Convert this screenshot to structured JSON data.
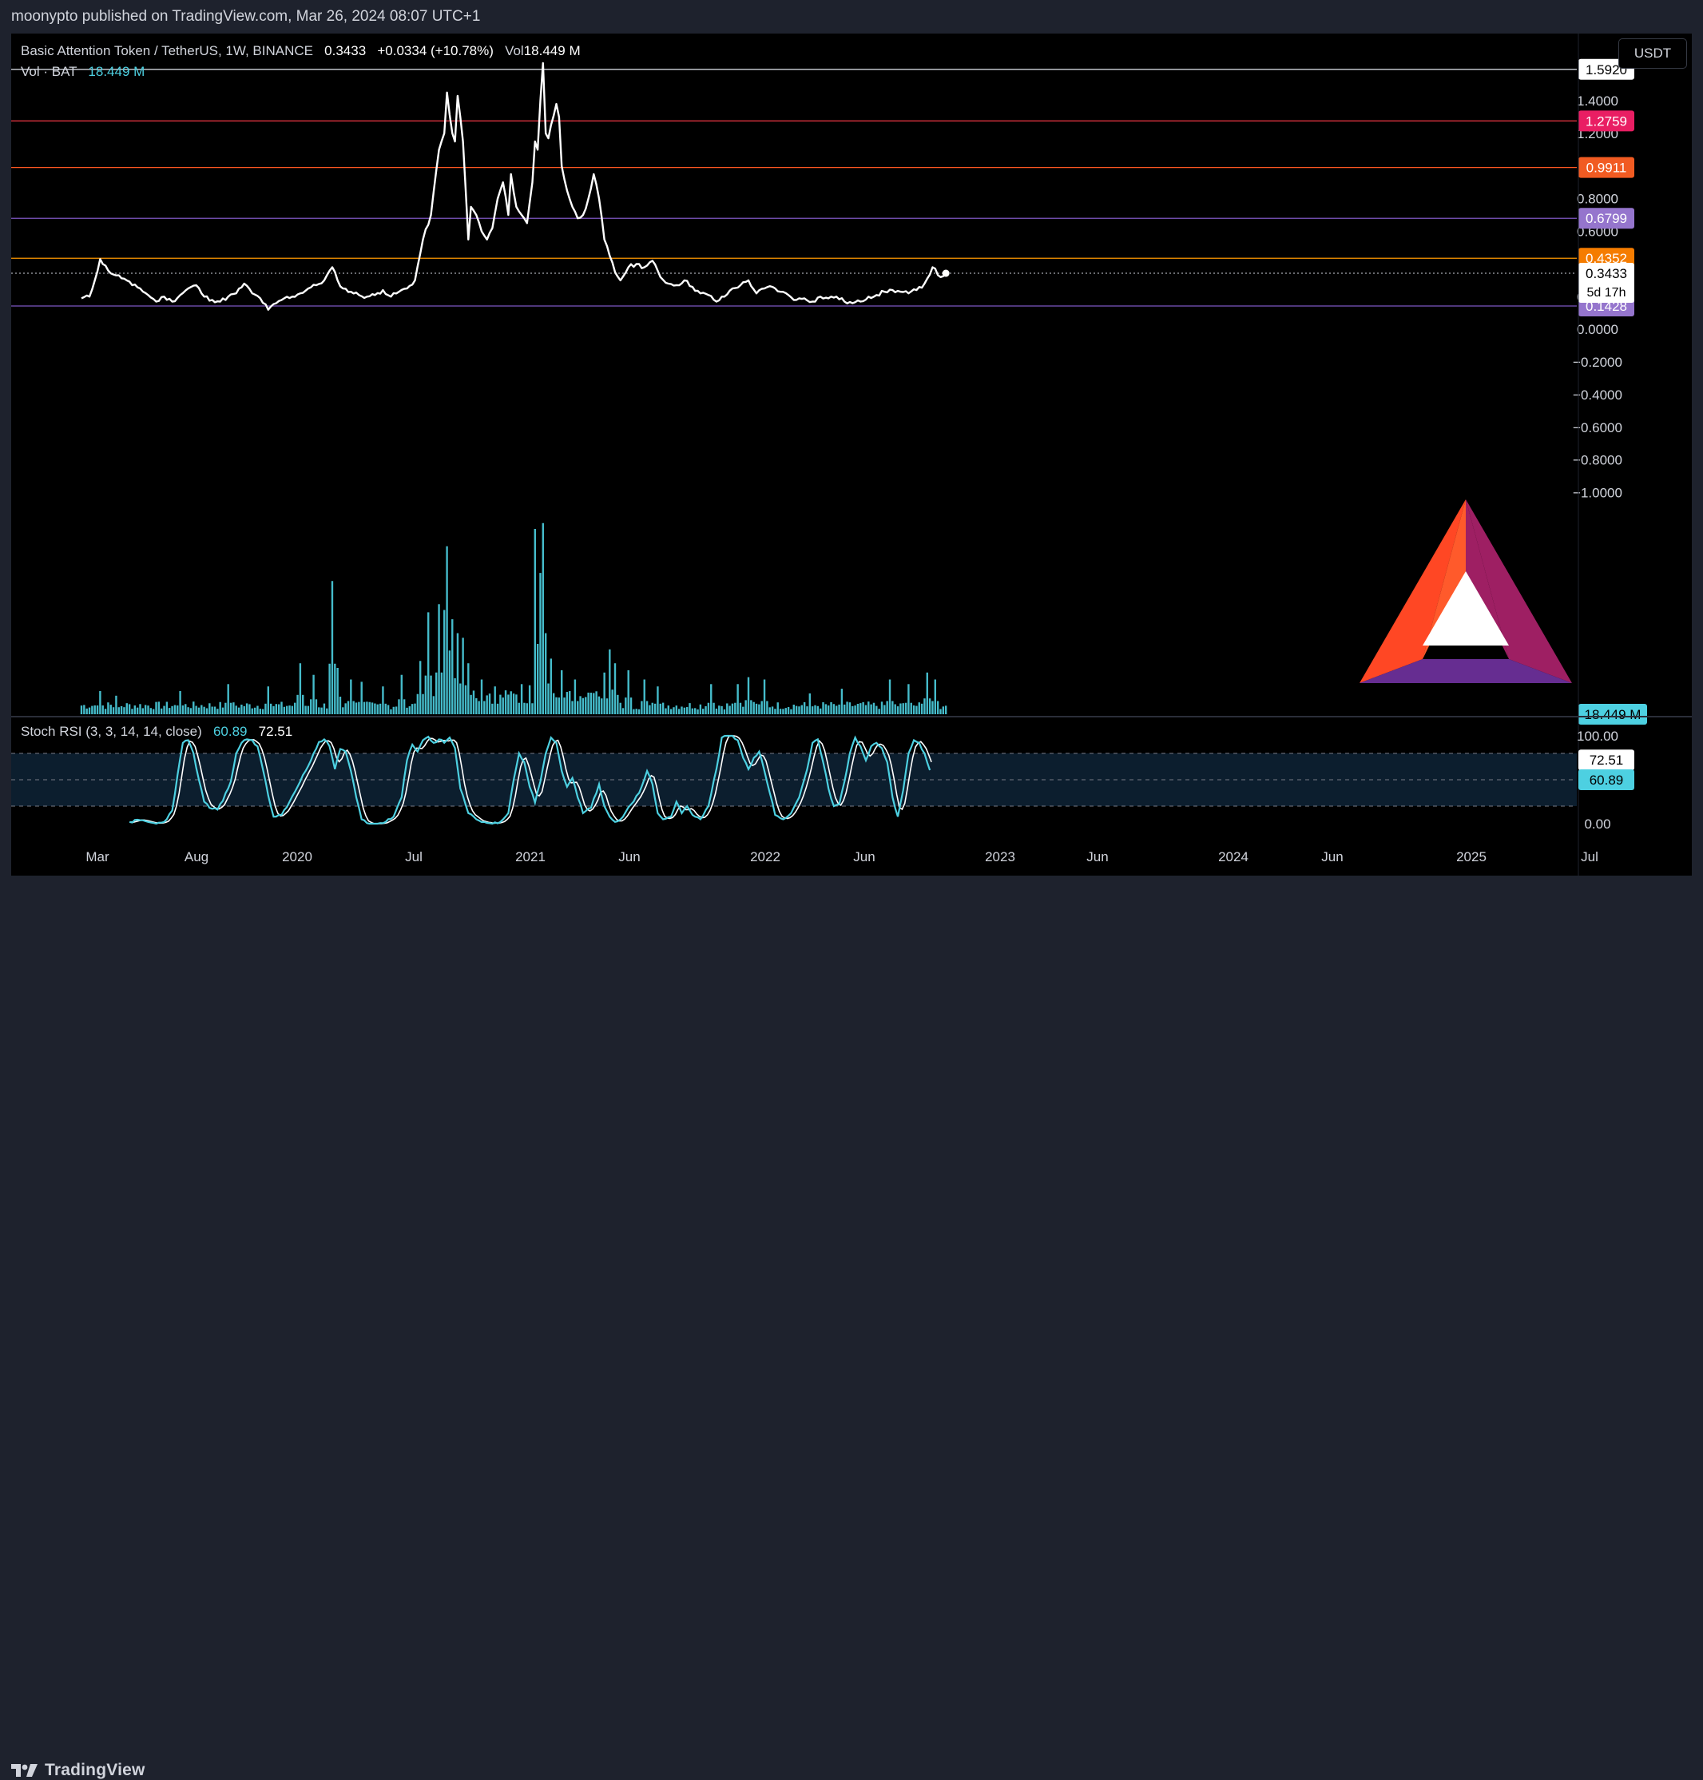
{
  "header": {
    "publisher": "moonypto published on TradingView.com, Mar 26, 2024 08:07 UTC+1"
  },
  "legend": {
    "symbol": "Basic Attention Token / TetherUS, 1W, BINANCE",
    "last": "0.3433",
    "change": "+0.0334 (+10.78%)",
    "vol_label": "Vol",
    "vol_value": "18.449 M",
    "vol_line_label": "Vol · BAT",
    "vol_line_value": "18.449 M",
    "stoch_label": "Stoch RSI (3, 3, 14, 14, close)",
    "stoch_k": "60.89",
    "stoch_d": "72.51"
  },
  "currency": "USDT",
  "colors": {
    "price_line": "#ffffff",
    "volume": "#4dd0e1",
    "stoch_k": "#4dd0e1",
    "stoch_d": "#ffffff",
    "level_white": "#d1d4dc",
    "level_red": "#f23645",
    "level_orange_red": "#ff5722",
    "level_purple": "#7e57c2",
    "level_orange": "#ff9800",
    "label_pink": "#e91e63",
    "label_orange_red": "#f15b22",
    "label_purple": "#9575cd",
    "label_orange": "#f57c00",
    "label_volume": "#4dd0e1"
  },
  "footer": {
    "brand": "TradingView",
    "logo_icon": "tradingview-logo-icon"
  },
  "watermark_icon": "bat-triangle-logo",
  "chart_data": {
    "type": "line",
    "title": "Basic Attention Token / TetherUS, 1W, BINANCE",
    "x_ticks": [
      "Mar",
      "Aug",
      "2020",
      "Jul",
      "2021",
      "Jun",
      "2022",
      "Jun",
      "2023",
      "Jun",
      "2024",
      "Jun",
      "2025",
      "Jul"
    ],
    "y_ticks": [
      "1.4000",
      "1.2000",
      "0.8000",
      "0.6000",
      "0.2000",
      "0.0000",
      "−0.2000",
      "−0.4000",
      "−0.6000",
      "−0.8000",
      "−1.0000"
    ],
    "ylim": [
      -1.1,
      1.65
    ],
    "last_price_label": "0.3433",
    "countdown_label": "5d 17h",
    "levels": [
      {
        "value": 1.592,
        "label": "1.5920",
        "color": "white"
      },
      {
        "value": 1.2759,
        "label": "1.2759",
        "color": "pink"
      },
      {
        "value": 0.9911,
        "label": "0.9911",
        "color": "orange-red"
      },
      {
        "value": 0.6799,
        "label": "0.6799",
        "color": "purple"
      },
      {
        "value": 0.4352,
        "label": "0.4352",
        "color": "orange"
      },
      {
        "value": 0.1428,
        "label": "0.1428",
        "color": "purple"
      }
    ],
    "price_series": {
      "name": "BAT/USDT",
      "anchors": [
        [
          0,
          0.19
        ],
        [
          3,
          0.2
        ],
        [
          5,
          0.3
        ],
        [
          7,
          0.43
        ],
        [
          10,
          0.36
        ],
        [
          13,
          0.33
        ],
        [
          16,
          0.31
        ],
        [
          19,
          0.27
        ],
        [
          22,
          0.25
        ],
        [
          25,
          0.21
        ],
        [
          28,
          0.17
        ],
        [
          31,
          0.2
        ],
        [
          34,
          0.17
        ],
        [
          37,
          0.21
        ],
        [
          40,
          0.25
        ],
        [
          43,
          0.27
        ],
        [
          46,
          0.2
        ],
        [
          49,
          0.18
        ],
        [
          52,
          0.17
        ],
        [
          55,
          0.2
        ],
        [
          58,
          0.22
        ],
        [
          61,
          0.28
        ],
        [
          64,
          0.22
        ],
        [
          67,
          0.19
        ],
        [
          70,
          0.12
        ],
        [
          73,
          0.16
        ],
        [
          76,
          0.19
        ],
        [
          79,
          0.2
        ],
        [
          82,
          0.22
        ],
        [
          85,
          0.25
        ],
        [
          88,
          0.27
        ],
        [
          91,
          0.3
        ],
        [
          94,
          0.38
        ],
        [
          96,
          0.3
        ],
        [
          98,
          0.25
        ],
        [
          101,
          0.23
        ],
        [
          104,
          0.21
        ],
        [
          107,
          0.2
        ],
        [
          110,
          0.21
        ],
        [
          113,
          0.24
        ],
        [
          116,
          0.2
        ],
        [
          119,
          0.23
        ],
        [
          122,
          0.25
        ],
        [
          125,
          0.3
        ],
        [
          128,
          0.55
        ],
        [
          131,
          0.7
        ],
        [
          134,
          1.1
        ],
        [
          136,
          1.2
        ],
        [
          137,
          1.45
        ],
        [
          139,
          1.2
        ],
        [
          140,
          1.15
        ],
        [
          141,
          1.43
        ],
        [
          143,
          1.15
        ],
        [
          145,
          0.55
        ],
        [
          146,
          0.75
        ],
        [
          148,
          0.7
        ],
        [
          150,
          0.6
        ],
        [
          152,
          0.55
        ],
        [
          154,
          0.62
        ],
        [
          156,
          0.8
        ],
        [
          158,
          0.9
        ],
        [
          160,
          0.7
        ],
        [
          161,
          0.95
        ],
        [
          163,
          0.75
        ],
        [
          165,
          0.7
        ],
        [
          167,
          0.65
        ],
        [
          169,
          0.9
        ],
        [
          170,
          1.15
        ],
        [
          171,
          1.1
        ],
        [
          172,
          1.4
        ],
        [
          173,
          1.63
        ],
        [
          174,
          1.2
        ],
        [
          175,
          1.17
        ],
        [
          176,
          1.25
        ],
        [
          178,
          1.38
        ],
        [
          179,
          1.3
        ],
        [
          180,
          1.0
        ],
        [
          182,
          0.85
        ],
        [
          184,
          0.75
        ],
        [
          186,
          0.68
        ],
        [
          188,
          0.7
        ],
        [
          190,
          0.8
        ],
        [
          192,
          0.95
        ],
        [
          194,
          0.8
        ],
        [
          196,
          0.55
        ],
        [
          198,
          0.45
        ],
        [
          200,
          0.35
        ],
        [
          202,
          0.3
        ],
        [
          205,
          0.38
        ],
        [
          208,
          0.4
        ],
        [
          211,
          0.38
        ],
        [
          214,
          0.42
        ],
        [
          217,
          0.32
        ],
        [
          220,
          0.28
        ],
        [
          223,
          0.27
        ],
        [
          226,
          0.3
        ],
        [
          229,
          0.26
        ],
        [
          232,
          0.22
        ],
        [
          235,
          0.21
        ],
        [
          238,
          0.17
        ],
        [
          241,
          0.2
        ],
        [
          244,
          0.25
        ],
        [
          247,
          0.27
        ],
        [
          250,
          0.3
        ],
        [
          253,
          0.22
        ],
        [
          256,
          0.25
        ],
        [
          259,
          0.26
        ],
        [
          262,
          0.23
        ],
        [
          265,
          0.21
        ],
        [
          268,
          0.18
        ],
        [
          271,
          0.19
        ],
        [
          274,
          0.17
        ],
        [
          277,
          0.2
        ],
        [
          280,
          0.19
        ],
        [
          283,
          0.2
        ],
        [
          286,
          0.17
        ],
        [
          289,
          0.16
        ],
        [
          292,
          0.17
        ],
        [
          295,
          0.2
        ],
        [
          298,
          0.21
        ],
        [
          301,
          0.23
        ],
        [
          304,
          0.24
        ],
        [
          307,
          0.23
        ],
        [
          310,
          0.22
        ],
        [
          313,
          0.24
        ],
        [
          316,
          0.28
        ],
        [
          319,
          0.38
        ],
        [
          322,
          0.32
        ],
        [
          324,
          0.3433
        ]
      ]
    },
    "volume_series": {
      "name": "Vol · BAT",
      "unit": "M",
      "spikes": [
        [
          7,
          20
        ],
        [
          13,
          16
        ],
        [
          37,
          20
        ],
        [
          55,
          26
        ],
        [
          70,
          24
        ],
        [
          82,
          44
        ],
        [
          87,
          34
        ],
        [
          94,
          115
        ],
        [
          96,
          40
        ],
        [
          101,
          30
        ],
        [
          105,
          28
        ],
        [
          113,
          24
        ],
        [
          120,
          34
        ],
        [
          127,
          46
        ],
        [
          130,
          88
        ],
        [
          134,
          95
        ],
        [
          136,
          90
        ],
        [
          137,
          145
        ],
        [
          139,
          82
        ],
        [
          141,
          70
        ],
        [
          143,
          66
        ],
        [
          145,
          44
        ],
        [
          150,
          30
        ],
        [
          155,
          24
        ],
        [
          165,
          26
        ],
        [
          168,
          25
        ],
        [
          170,
          160
        ],
        [
          172,
          122
        ],
        [
          173,
          165
        ],
        [
          174,
          70
        ],
        [
          176,
          48
        ],
        [
          180,
          38
        ],
        [
          185,
          30
        ],
        [
          196,
          36
        ],
        [
          198,
          56
        ],
        [
          200,
          44
        ],
        [
          205,
          38
        ],
        [
          211,
          30
        ],
        [
          216,
          24
        ],
        [
          236,
          26
        ],
        [
          246,
          26
        ],
        [
          250,
          32
        ],
        [
          256,
          30
        ],
        [
          273,
          18
        ],
        [
          285,
          22
        ],
        [
          303,
          30
        ],
        [
          310,
          26
        ],
        [
          317,
          36
        ],
        [
          320,
          30
        ]
      ]
    },
    "stoch_rsi": {
      "ylim": [
        0,
        100
      ],
      "y_ticks": [
        "100.00",
        "0.00"
      ],
      "bands": [
        80,
        50,
        20
      ],
      "k_value": "60.89",
      "d_value": "72.51",
      "anchors": [
        [
          18,
          2
        ],
        [
          22,
          4
        ],
        [
          25,
          2
        ],
        [
          28,
          0
        ],
        [
          31,
          2
        ],
        [
          34,
          15
        ],
        [
          36,
          55
        ],
        [
          38,
          92
        ],
        [
          40,
          95
        ],
        [
          42,
          80
        ],
        [
          44,
          50
        ],
        [
          46,
          25
        ],
        [
          48,
          18
        ],
        [
          51,
          16
        ],
        [
          53,
          26
        ],
        [
          56,
          48
        ],
        [
          58,
          80
        ],
        [
          60,
          92
        ],
        [
          62,
          96
        ],
        [
          64,
          95
        ],
        [
          66,
          88
        ],
        [
          68,
          62
        ],
        [
          70,
          32
        ],
        [
          72,
          8
        ],
        [
          75,
          10
        ],
        [
          78,
          25
        ],
        [
          81,
          42
        ],
        [
          84,
          60
        ],
        [
          87,
          80
        ],
        [
          89,
          93
        ],
        [
          91,
          96
        ],
        [
          93,
          88
        ],
        [
          95,
          62
        ],
        [
          97,
          85
        ],
        [
          99,
          82
        ],
        [
          101,
          60
        ],
        [
          103,
          30
        ],
        [
          105,
          5
        ],
        [
          108,
          0
        ],
        [
          111,
          0
        ],
        [
          114,
          2
        ],
        [
          117,
          8
        ],
        [
          120,
          30
        ],
        [
          122,
          72
        ],
        [
          124,
          90
        ],
        [
          126,
          82
        ],
        [
          128,
          95
        ],
        [
          130,
          99
        ],
        [
          132,
          92
        ],
        [
          134,
          96
        ],
        [
          136,
          92
        ],
        [
          138,
          98
        ],
        [
          140,
          86
        ],
        [
          142,
          40
        ],
        [
          145,
          12
        ],
        [
          148,
          5
        ],
        [
          151,
          2
        ],
        [
          154,
          0
        ],
        [
          157,
          2
        ],
        [
          160,
          12
        ],
        [
          162,
          50
        ],
        [
          164,
          80
        ],
        [
          166,
          70
        ],
        [
          168,
          42
        ],
        [
          170,
          24
        ],
        [
          172,
          48
        ],
        [
          174,
          80
        ],
        [
          176,
          98
        ],
        [
          178,
          92
        ],
        [
          180,
          60
        ],
        [
          182,
          42
        ],
        [
          184,
          52
        ],
        [
          186,
          30
        ],
        [
          188,
          12
        ],
        [
          191,
          18
        ],
        [
          194,
          45
        ],
        [
          196,
          20
        ],
        [
          198,
          8
        ],
        [
          200,
          2
        ],
        [
          203,
          8
        ],
        [
          206,
          22
        ],
        [
          209,
          35
        ],
        [
          212,
          60
        ],
        [
          214,
          45
        ],
        [
          216,
          12
        ],
        [
          218,
          5
        ],
        [
          221,
          8
        ],
        [
          223,
          25
        ],
        [
          225,
          12
        ],
        [
          227,
          20
        ],
        [
          229,
          10
        ],
        [
          232,
          5
        ],
        [
          235,
          20
        ],
        [
          238,
          62
        ],
        [
          240,
          98
        ],
        [
          242,
          100
        ],
        [
          244,
          100
        ],
        [
          246,
          95
        ],
        [
          248,
          75
        ],
        [
          250,
          62
        ],
        [
          252,
          75
        ],
        [
          254,
          82
        ],
        [
          256,
          60
        ],
        [
          258,
          35
        ],
        [
          260,
          10
        ],
        [
          263,
          5
        ],
        [
          266,
          12
        ],
        [
          269,
          30
        ],
        [
          272,
          62
        ],
        [
          274,
          92
        ],
        [
          276,
          96
        ],
        [
          278,
          70
        ],
        [
          280,
          40
        ],
        [
          282,
          20
        ],
        [
          284,
          22
        ],
        [
          286,
          48
        ],
        [
          288,
          80
        ],
        [
          290,
          98
        ],
        [
          292,
          88
        ],
        [
          294,
          72
        ],
        [
          296,
          88
        ],
        [
          298,
          92
        ],
        [
          300,
          86
        ],
        [
          302,
          70
        ],
        [
          304,
          30
        ],
        [
          306,
          8
        ],
        [
          308,
          38
        ],
        [
          310,
          80
        ],
        [
          312,
          95
        ],
        [
          314,
          92
        ],
        [
          316,
          80
        ],
        [
          318,
          60.89
        ]
      ]
    }
  }
}
